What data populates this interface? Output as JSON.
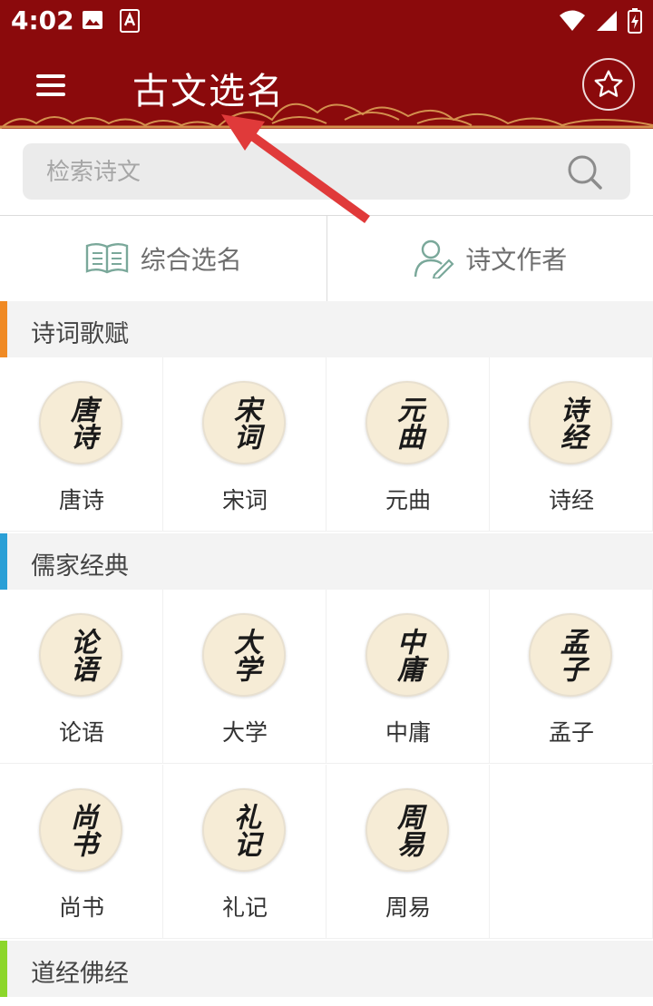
{
  "status": {
    "time": "4:02"
  },
  "header": {
    "title": "古文选名"
  },
  "search": {
    "placeholder": "检索诗文"
  },
  "tabs": [
    {
      "label": "综合选名"
    },
    {
      "label": "诗文作者"
    }
  ],
  "sections": [
    {
      "title": "诗词歌赋",
      "color": "#f08a24",
      "items": [
        {
          "label": "唐诗",
          "glyph": "唐诗"
        },
        {
          "label": "宋词",
          "glyph": "宋词"
        },
        {
          "label": "元曲",
          "glyph": "元曲"
        },
        {
          "label": "诗经",
          "glyph": "诗经"
        }
      ]
    },
    {
      "title": "儒家经典",
      "color": "#2a9fd6",
      "items": [
        {
          "label": "论语",
          "glyph": "论语"
        },
        {
          "label": "大学",
          "glyph": "大学"
        },
        {
          "label": "中庸",
          "glyph": "中庸"
        },
        {
          "label": "孟子",
          "glyph": "孟子"
        },
        {
          "label": "尚书",
          "glyph": "尚书"
        },
        {
          "label": "礼记",
          "glyph": "礼记"
        },
        {
          "label": "周易",
          "glyph": "周易"
        }
      ]
    },
    {
      "title": "道经佛经",
      "color": "#8cd62a",
      "items": []
    }
  ],
  "colors": {
    "brand": "#8b0a0c",
    "arrow": "#e03a3a"
  }
}
